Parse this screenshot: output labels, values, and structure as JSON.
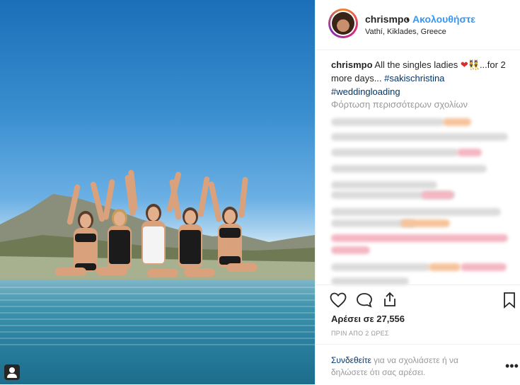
{
  "post": {
    "username": "chrismpo",
    "separator": "•",
    "follow_label": "Ακολουθήστε",
    "location": "Vathí, Kiklades, Greece",
    "caption_user": "chrismpo",
    "caption_text": "All the singles ladies",
    "caption_emoji": "❤👯",
    "caption_rest": "...for 2 more days...",
    "hashtag1": "#sakischristina",
    "hashtag2": "#weddingloading",
    "load_more": "Φόρτωση περισσότερων σχολίων",
    "likes": "Αρέσει σε 27,556",
    "time_ago": "ΠΡΙΝ ΑΠΟ 2 ΩΡΕΣ",
    "login_link": "Συνδεθείτε",
    "login_rest": "για να σχολιάσετε ή να δηλώσετε ότι σας αρέσει.",
    "options": "•••"
  },
  "icons": {
    "like": "heart-icon",
    "comment": "comment-icon",
    "share": "share-icon",
    "save": "bookmark-icon",
    "user_tag": "user-icon",
    "more": "more-options-icon"
  },
  "colors": {
    "accent": "#3897f0",
    "link": "#003569",
    "muted": "#999999"
  }
}
